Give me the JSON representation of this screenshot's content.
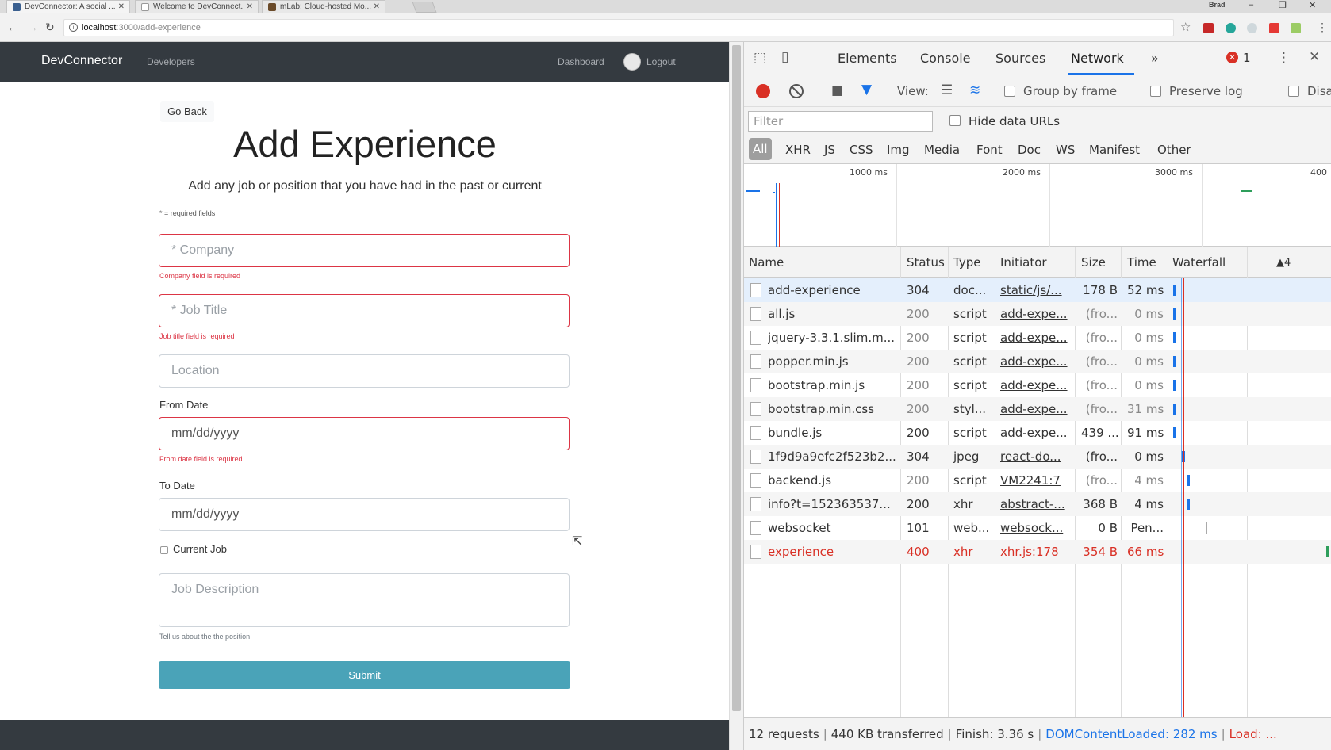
{
  "browser": {
    "tabs": [
      {
        "label": "DevConnector: A social ...",
        "favicon_color": "#3a5f8f"
      },
      {
        "label": "Welcome to DevConnect...",
        "favicon_color": "#cfcfcf"
      },
      {
        "label": "mLab: Cloud-hosted Mo...",
        "favicon_color": "#6b4b2a"
      }
    ],
    "user_label": "Brad",
    "url_host": "localhost",
    "url_path": ":3000/add-experience",
    "minimize": "–",
    "restore": "❐",
    "close": "✕",
    "back": "←",
    "forward": "→",
    "reload": "↻",
    "star": "☆",
    "kebab": "⋮"
  },
  "app_nav": {
    "brand": "DevConnector",
    "developers": "Developers",
    "dashboard": "Dashboard",
    "logout": "Logout"
  },
  "form": {
    "go_back": "Go Back",
    "title": "Add Experience",
    "lead": "Add any job or position that you have had in the past or current",
    "required_note": "* = required fields",
    "company_placeholder": "* Company",
    "company_error": "Company field is required",
    "job_title_placeholder": "* Job Title",
    "job_title_error": "Job title field is required",
    "location_placeholder": "Location",
    "from_label": "From Date",
    "from_value": "mm/dd/yyyy",
    "from_error": "From date field is required",
    "to_label": "To Date",
    "to_value": "mm/dd/yyyy",
    "current_label": "Current Job",
    "description_placeholder": "Job Description",
    "description_hint": "Tell us about the the position",
    "submit": "Submit"
  },
  "devtools": {
    "tabs": [
      "Elements",
      "Console",
      "Sources",
      "Network"
    ],
    "active_tab": "Network",
    "more": "»",
    "error_count": "1",
    "close": "✕",
    "kebab": "⋮",
    "toolbar": {
      "view_label": "View:",
      "group_by_frame": "Group by frame",
      "preserve_log": "Preserve log",
      "disable_cache": "Disa"
    },
    "filter_placeholder": "Filter",
    "hide_data_urls": "Hide data URLs",
    "types": [
      "All",
      "XHR",
      "JS",
      "CSS",
      "Img",
      "Media",
      "Font",
      "Doc",
      "WS",
      "Manifest",
      "Other"
    ],
    "overview_ticks": [
      "1000 ms",
      "2000 ms",
      "3000 ms",
      "400"
    ],
    "columns": [
      "Name",
      "Status",
      "Type",
      "Initiator",
      "Size",
      "Time",
      "Waterfall"
    ],
    "sort_indicator": "▲4",
    "rows": [
      {
        "name": "add-experience",
        "status": "304",
        "type": "doc...",
        "initiator": "static/js/...",
        "size": "178 B",
        "time": "52 ms",
        "dim": false,
        "error": false,
        "wf_fraction": 0.005
      },
      {
        "name": "all.js",
        "status": "200",
        "type": "script",
        "initiator": "add-expe...",
        "size": "(fro...",
        "time": "0 ms",
        "dim": true,
        "error": false,
        "wf_fraction": 0.005
      },
      {
        "name": "jquery-3.3.1.slim.m...",
        "status": "200",
        "type": "script",
        "initiator": "add-expe...",
        "size": "(fro...",
        "time": "0 ms",
        "dim": true,
        "error": false,
        "wf_fraction": 0.005
      },
      {
        "name": "popper.min.js",
        "status": "200",
        "type": "script",
        "initiator": "add-expe...",
        "size": "(fro...",
        "time": "0 ms",
        "dim": true,
        "error": false,
        "wf_fraction": 0.005
      },
      {
        "name": "bootstrap.min.js",
        "status": "200",
        "type": "script",
        "initiator": "add-expe...",
        "size": "(fro...",
        "time": "0 ms",
        "dim": true,
        "error": false,
        "wf_fraction": 0.005
      },
      {
        "name": "bootstrap.min.css",
        "status": "200",
        "type": "styl...",
        "initiator": "add-expe...",
        "size": "(fro...",
        "time": "31 ms",
        "dim": true,
        "error": false,
        "wf_fraction": 0.005
      },
      {
        "name": "bundle.js",
        "status": "200",
        "type": "script",
        "initiator": "add-expe...",
        "size": "439 ...",
        "time": "91 ms",
        "dim": false,
        "error": false,
        "wf_fraction": 0.005
      },
      {
        "name": "1f9d9a9efc2f523b2...",
        "status": "304",
        "type": "jpeg",
        "initiator": "react-do...",
        "size": "(fro...",
        "time": "0 ms",
        "dim": false,
        "error": false,
        "wf_fraction": 0.06
      },
      {
        "name": "backend.js",
        "status": "200",
        "type": "script",
        "initiator": "VM2241:7",
        "size": "(fro...",
        "time": "4 ms",
        "dim": true,
        "error": false,
        "wf_fraction": 0.09
      },
      {
        "name": "info?t=152363537...",
        "status": "200",
        "type": "xhr",
        "initiator": "abstract-...",
        "size": "368 B",
        "time": "4 ms",
        "dim": false,
        "error": false,
        "wf_fraction": 0.09
      },
      {
        "name": "websocket",
        "status": "101",
        "type": "web...",
        "initiator": "websock...",
        "size": "0 B",
        "time": "Pen...",
        "dim": false,
        "error": false,
        "wf_fraction": 0.22
      },
      {
        "name": "experience",
        "status": "400",
        "type": "xhr",
        "initiator": "xhr.js:178",
        "size": "354 B",
        "time": "66 ms",
        "dim": false,
        "error": true,
        "wf_fraction": 0.99
      }
    ],
    "status": {
      "requests": "12 requests",
      "transferred": "440 KB transferred",
      "finish": "Finish: 3.36 s",
      "dom": "DOMContentLoaded: 282 ms",
      "load": "Load: ..."
    }
  },
  "colors": {
    "accent": "#1a73e8",
    "error": "#d93025",
    "navbar": "#343a40",
    "submit": "#4aa3b8",
    "invalid": "#dc3545"
  }
}
